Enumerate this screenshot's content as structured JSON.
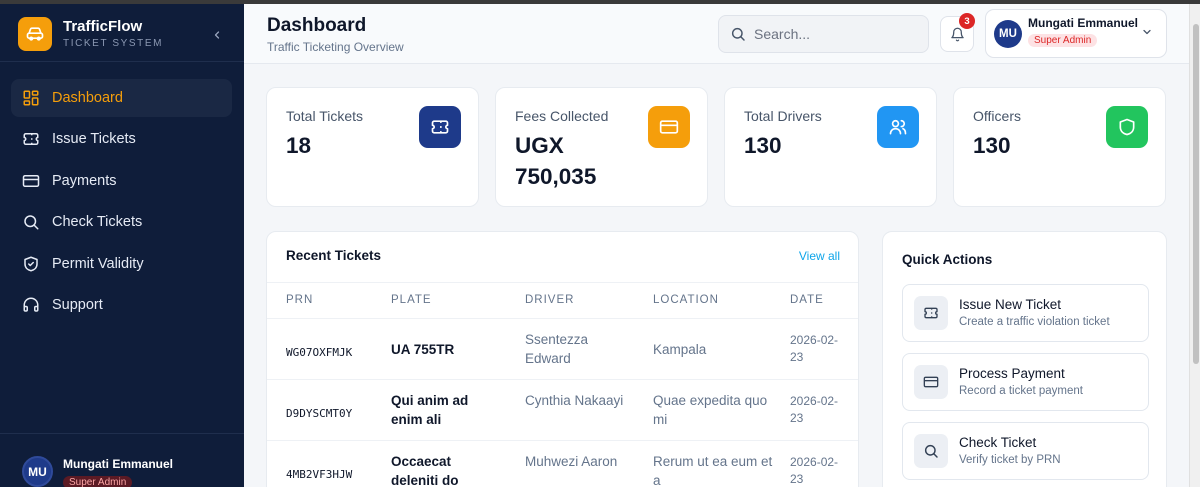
{
  "brand": {
    "name": "TrafficFlow",
    "subtitle": "TICKET SYSTEM",
    "accent": "#f59e0b"
  },
  "sidebar": {
    "items": [
      {
        "label": "Dashboard",
        "icon": "dashboard-grid-icon",
        "active": true
      },
      {
        "label": "Issue Tickets",
        "icon": "ticket-icon"
      },
      {
        "label": "Payments",
        "icon": "credit-card-icon"
      },
      {
        "label": "Check Tickets",
        "icon": "search-icon"
      },
      {
        "label": "Permit Validity",
        "icon": "shield-check-icon"
      },
      {
        "label": "Support",
        "icon": "headset-icon"
      }
    ],
    "user": {
      "initials": "MU",
      "name": "Mungati Emmanuel",
      "role": "Super Admin"
    }
  },
  "header": {
    "title": "Dashboard",
    "subtitle": "Traffic Ticketing Overview",
    "search_placeholder": "Search...",
    "notifications_count": "3",
    "user": {
      "initials": "MU",
      "name": "Mungati Emmanuel",
      "role": "Super Admin"
    }
  },
  "stats": [
    {
      "label": "Total Tickets",
      "value": "18",
      "icon": "ticket-icon",
      "color": "#1e3a8a"
    },
    {
      "label": "Fees Collected",
      "value": "UGX 750,035",
      "icon": "credit-card-icon",
      "color": "#f59e0b"
    },
    {
      "label": "Total Drivers",
      "value": "130",
      "icon": "users-icon",
      "color": "#2196f3"
    },
    {
      "label": "Officers",
      "value": "130",
      "icon": "shield-icon",
      "color": "#22c55e"
    }
  ],
  "recent": {
    "title": "Recent Tickets",
    "view_all": "View all",
    "columns": [
      "PRN",
      "PLATE",
      "DRIVER",
      "LOCATION",
      "DATE"
    ],
    "rows": [
      {
        "prn": "WG07OXFMJK",
        "plate": "UA 755TR",
        "driver": "Ssentezza Edward",
        "location": "Kampala",
        "date": "2026-02-23"
      },
      {
        "prn": "D9DYSCMT0Y",
        "plate": "Qui anim ad enim ali",
        "driver": "Cynthia Nakaayi",
        "location": "Quae expedita quo mi",
        "date": "2026-02-23"
      },
      {
        "prn": "4MB2VF3HJW",
        "plate": "Occaecat deleniti do",
        "driver": "Muhwezi Aaron",
        "location": "Rerum ut ea eum et a",
        "date": "2026-02-23"
      }
    ]
  },
  "quick_actions": {
    "title": "Quick Actions",
    "items": [
      {
        "label": "Issue New Ticket",
        "description": "Create a traffic violation ticket",
        "icon": "ticket-icon"
      },
      {
        "label": "Process Payment",
        "description": "Record a ticket payment",
        "icon": "credit-card-icon"
      },
      {
        "label": "Check Ticket",
        "description": "Verify ticket by PRN",
        "icon": "search-icon"
      }
    ]
  }
}
